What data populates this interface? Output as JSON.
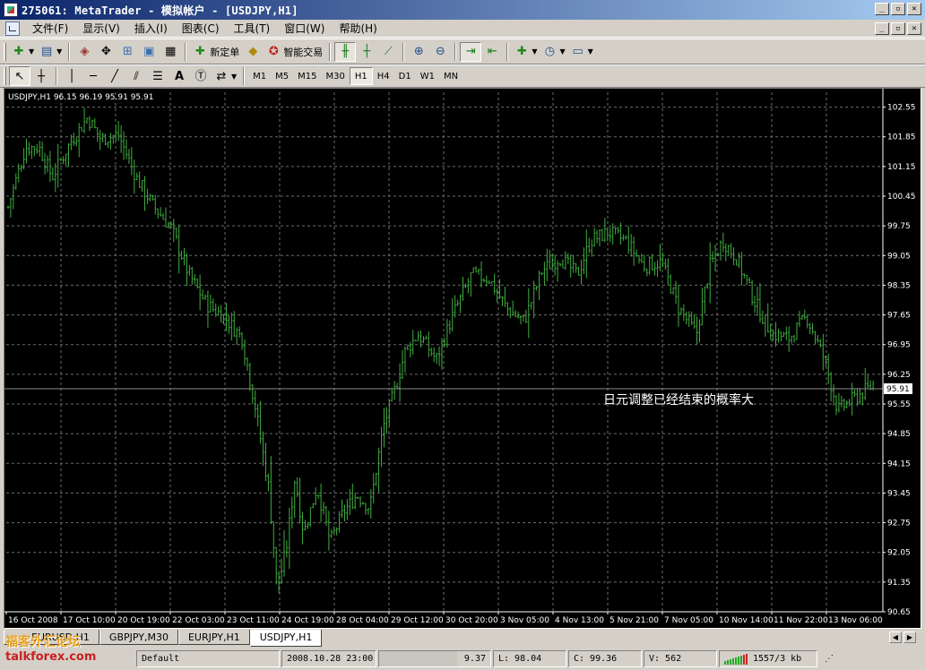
{
  "window": {
    "title": "275061: MetaTrader - 模拟帐户 - [USDJPY,H1]",
    "buttons": [
      "_",
      "▫",
      "✕"
    ]
  },
  "menu": {
    "items": [
      "文件(F)",
      "显示(V)",
      "插入(I)",
      "图表(C)",
      "工具(T)",
      "窗口(W)",
      "帮助(H)"
    ]
  },
  "toolbar": {
    "new_order_label": "新定单",
    "expert_label": "智能交易",
    "timeframes": [
      "M1",
      "M5",
      "M15",
      "M30",
      "H1",
      "H4",
      "D1",
      "W1",
      "MN"
    ],
    "active_timeframe": "H1"
  },
  "chart": {
    "info_text": "USDJPY,H1  96.15 96.19 95.91 95.91",
    "annotation": "日元调整已经结束的概率大",
    "current_price_label": "95.91",
    "price_tick_labels": [
      "102.55",
      "101.85",
      "101.15",
      "100.45",
      "99.75",
      "99.05",
      "98.35",
      "97.65",
      "96.95",
      "96.25",
      "95.55",
      "94.85",
      "94.15",
      "93.45",
      "92.75",
      "92.05",
      "91.35",
      "90.65"
    ],
    "date_tick_labels": [
      "16 Oct 2008",
      "17 Oct 10:00",
      "20 Oct 19:00",
      "22 Oct 03:00",
      "23 Oct 11:00",
      "24 Oct 19:00",
      "28 Oct 04:00",
      "29 Oct 12:00",
      "30 Oct 20:00",
      "3 Nov 05:00",
      "4 Nov 13:00",
      "5 Nov 21:00",
      "7 Nov 05:00",
      "10 Nov 14:00",
      "11 Nov 22:00",
      "13 Nov 06:00"
    ],
    "colors": {
      "background": "#000000",
      "grid": "#6b6b6b",
      "bars": "#3fae3f",
      "text": "#ffffff",
      "bid_line": "#8a8a8a"
    }
  },
  "chart_data": {
    "type": "ohlc",
    "symbol": "USDJPY",
    "timeframe": "H1",
    "ylim": [
      90.65,
      102.9
    ],
    "last_price": 95.91,
    "ohlc_last": {
      "open": 96.15,
      "high": 96.19,
      "low": 95.91,
      "close": 95.91
    },
    "bar_count": 330,
    "close_path": [
      [
        0,
        100.2
      ],
      [
        8,
        101.6
      ],
      [
        14,
        101.6
      ],
      [
        20,
        100.9
      ],
      [
        28,
        101.7
      ],
      [
        36,
        102.3
      ],
      [
        42,
        101.8
      ],
      [
        50,
        101.9
      ],
      [
        58,
        100.9
      ],
      [
        66,
        100.2
      ],
      [
        74,
        99.7
      ],
      [
        82,
        98.6
      ],
      [
        90,
        97.9
      ],
      [
        98,
        97.6
      ],
      [
        106,
        97.1
      ],
      [
        112,
        95.5
      ],
      [
        118,
        93.6
      ],
      [
        122,
        91.2
      ],
      [
        126,
        92.1
      ],
      [
        130,
        93.8
      ],
      [
        134,
        92.5
      ],
      [
        140,
        93.6
      ],
      [
        146,
        92.3
      ],
      [
        152,
        93.0
      ],
      [
        158,
        93.4
      ],
      [
        164,
        93.1
      ],
      [
        170,
        95.0
      ],
      [
        176,
        96.0
      ],
      [
        180,
        96.8
      ],
      [
        186,
        97.2
      ],
      [
        194,
        96.6
      ],
      [
        202,
        97.7
      ],
      [
        210,
        98.6
      ],
      [
        218,
        98.5
      ],
      [
        226,
        97.8
      ],
      [
        234,
        97.5
      ],
      [
        242,
        98.7
      ],
      [
        250,
        99.0
      ],
      [
        258,
        98.6
      ],
      [
        264,
        99.4
      ],
      [
        272,
        99.6
      ],
      [
        280,
        99.4
      ],
      [
        288,
        98.8
      ],
      [
        296,
        98.9
      ],
      [
        304,
        97.8
      ],
      [
        312,
        97.2
      ],
      [
        318,
        98.8
      ],
      [
        324,
        99.4
      ],
      [
        330,
        99.0
      ],
      [
        338,
        98.0
      ],
      [
        346,
        97.2
      ],
      [
        354,
        97.1
      ],
      [
        362,
        97.6
      ],
      [
        370,
        96.6
      ],
      [
        376,
        95.4
      ],
      [
        384,
        95.7
      ],
      [
        392,
        96.0
      ]
    ]
  },
  "tabs": {
    "items": [
      "EURUSD,H1",
      "GBPJPY,M30",
      "EURJPY,H1",
      "USDJPY,H1"
    ],
    "active": "USDJPY,H1"
  },
  "status": {
    "profile": "Default",
    "datetime": "2008.10.28 23:00",
    "close": "9.37",
    "low": "L: 98.04",
    "close2": "C: 99.36",
    "volume": "V: 562",
    "traffic": "1557/3 kb"
  },
  "watermark": {
    "cn": "福客外汇论坛",
    "en": "talkforex.com"
  }
}
